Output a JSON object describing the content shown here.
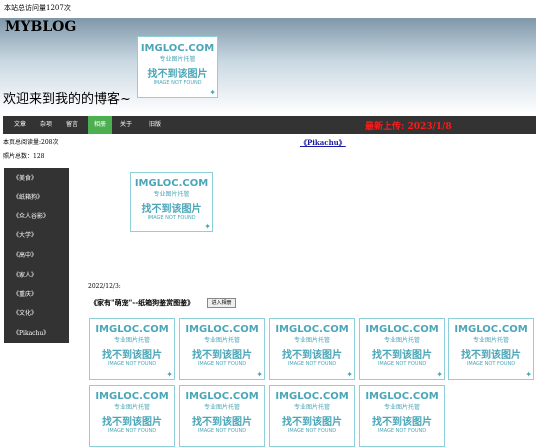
{
  "site": {
    "total_visits": "本站总访问量1207次",
    "title": "MYBLOG",
    "welcome": "欢迎来到我的的博客~"
  },
  "placeholder": {
    "brand": "IMGLOC.COM",
    "subtitle": "专业图片托管",
    "message": "找不到该图片",
    "note": "IMAGE NOT FOUND"
  },
  "nav": {
    "items": [
      "文章",
      "杂项",
      "留言",
      "相册",
      "关于",
      "旧版"
    ],
    "active": "相册",
    "latest_upload": "最新上传: 2023/1/8"
  },
  "stats": {
    "page_visits": "本页总阅读量:208次",
    "photo_count": "照片总数：128"
  },
  "featured_link": "《Pikachu》",
  "sidebar": {
    "items": [
      "《美食》",
      "《纸箱狗》",
      "《众人谷影》",
      "《大学》",
      "《高中》",
      "《家人》",
      "《重庆》",
      "《文化》",
      "《Pikachu》"
    ]
  },
  "post": {
    "date": "2022/12/3:",
    "title": "《家有\"萌宠\"--纸箱狗鉴赏图鉴》",
    "button": "进入相册"
  },
  "colors": {
    "nav_bg": "#333333",
    "nav_active": "#4caf50",
    "latest_upload": "#ff1a1a",
    "placeholder_accent": "#4aa6b8"
  }
}
